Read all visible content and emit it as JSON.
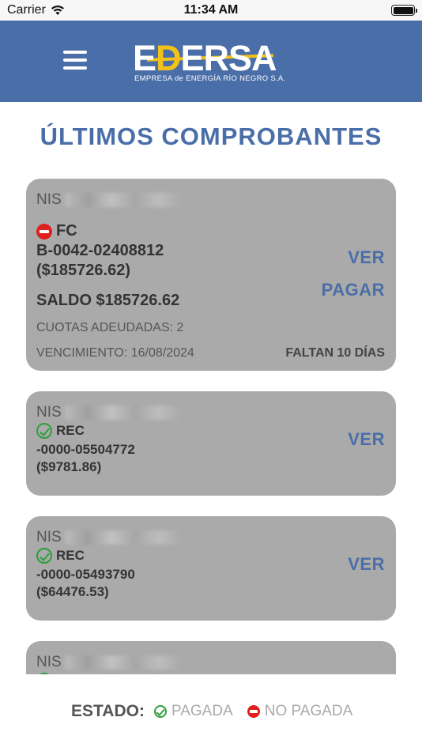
{
  "status_bar": {
    "carrier": "Carrier",
    "time": "11:34 AM"
  },
  "header": {
    "logo_prefix": "E",
    "logo_d": "D",
    "logo_rest": "ERSA",
    "logo_subtitle": "EMPRESA de ENERGÍA RÍO NEGRO S.A."
  },
  "page_title": "ÚLTIMOS COMPROBANTES",
  "cards": [
    {
      "nis_label": "NIS",
      "status": "no_pagada",
      "type": "FC",
      "number": "B-0042-02408812",
      "amount": "($185726.62)",
      "balance": "SALDO $185726.62",
      "installments": "CUOTAS ADEUDADAS: 2",
      "due_date": "VENCIMIENTO: 16/08/2024",
      "remaining": "FALTAN 10 DÍAS",
      "action_view": "VER",
      "action_pay": "PAGAR"
    },
    {
      "nis_label": "NIS",
      "status": "pagada",
      "type": "REC",
      "number": "-0000-05504772",
      "amount": "($9781.86)",
      "action_view": "VER"
    },
    {
      "nis_label": "NIS",
      "status": "pagada",
      "type": "REC",
      "number": "-0000-05493790",
      "amount": "($64476.53)",
      "action_view": "VER"
    },
    {
      "nis_label": "NIS",
      "status": "pagada"
    }
  ],
  "legend": {
    "title": "ESTADO:",
    "paid": "PAGADA",
    "unpaid": "NO PAGADA"
  },
  "colors": {
    "brand_blue": "#4a6ea8",
    "brand_yellow": "#f2c21b",
    "card_bg": "#aaaaaa",
    "paid_green": "#2e9e3c",
    "unpaid_red": "#e0201f"
  }
}
